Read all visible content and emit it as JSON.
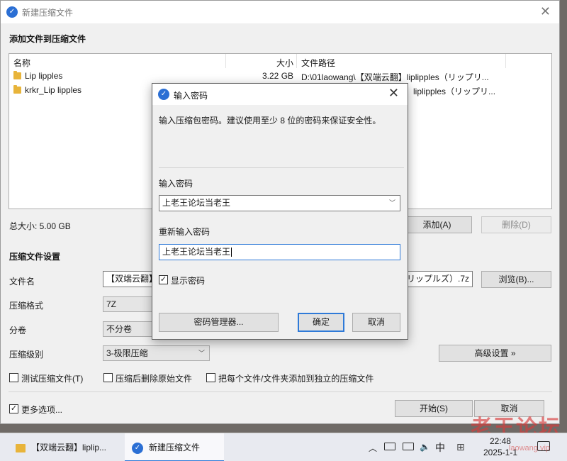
{
  "window": {
    "title": "新建压缩文件"
  },
  "add_section": {
    "heading": "添加文件到压缩文件"
  },
  "file_table": {
    "columns": [
      "名称",
      "大小",
      "文件路径"
    ],
    "rows": [
      {
        "name": "Lip lipples",
        "size": "3.22 GB",
        "path": "D:\\01laowang\\【双端云翻】liplipples（リップリ..."
      },
      {
        "name": "krkr_Lip lipples",
        "size": "",
        "path": "liplipples（リップリ..."
      }
    ]
  },
  "total_size": "总大小: 5.00 GB",
  "buttons": {
    "add": "添加(A)",
    "delete": "删除(D)",
    "browse": "浏览(B)...",
    "advanced": "高级设置 »",
    "start": "开始(S)",
    "cancel": "取消"
  },
  "settings": {
    "heading": "压缩文件设置",
    "filename_label": "文件名",
    "filename_value_left": "【双端云翻】",
    "filename_value_right": "リップルズ）.7z",
    "format_label": "压缩格式",
    "format_value": "7Z",
    "split_label": "分卷",
    "split_value": "不分卷",
    "level_label": "压缩级别",
    "level_value": "3-极限压缩"
  },
  "checkboxes": {
    "test": "测试压缩文件(T)",
    "delete_after": "压缩后删除原始文件",
    "separate": "把每个文件/文件夹添加到独立的压缩文件",
    "more_options": "更多选项..."
  },
  "dialog": {
    "title": "输入密码",
    "description": "输入压缩包密码。建议使用至少 8 位的密码来保证安全性。",
    "password_label": "输入密码",
    "password_value": "上老王论坛当老王",
    "confirm_label": "重新输入密码",
    "confirm_value": "上老王论坛当老王",
    "show_password": "显示密码",
    "manager_button": "密码管理器...",
    "ok_button": "确定",
    "cancel_button": "取消"
  },
  "taskbar": {
    "item1": "【双端云翻】liplip...",
    "item2": "新建压缩文件",
    "ime": "中",
    "time": "22:48",
    "date": "2025-1-1"
  },
  "watermark": {
    "main": "老王论坛",
    "sub": "laowang.vip"
  }
}
